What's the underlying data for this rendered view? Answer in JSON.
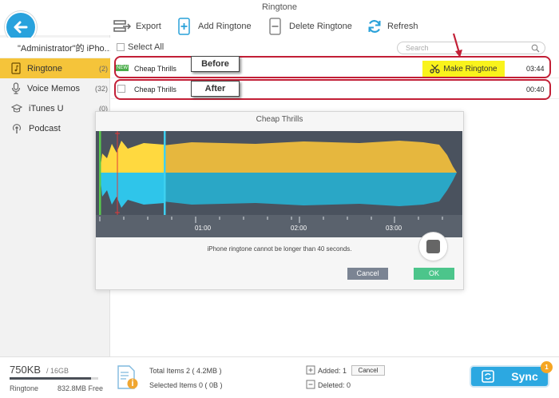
{
  "window": {
    "title": "Ringtone"
  },
  "toolbar": {
    "export_label": "Export",
    "add_label": "Add Ringtone",
    "delete_label": "Delete Ringtone",
    "refresh_label": "Refresh"
  },
  "sidebar": {
    "device_label": "\"Administrator\"的 iPho...",
    "items": [
      {
        "label": "Ringtone",
        "count": "(2)"
      },
      {
        "label": "Voice Memos",
        "count": "(32)"
      },
      {
        "label": "iTunes U",
        "count": "(0)"
      },
      {
        "label": "Podcast",
        "count": ""
      }
    ]
  },
  "list": {
    "select_all_label": "Select All",
    "search_placeholder": "Search",
    "rows": [
      {
        "title": "Cheap Thrills",
        "duration": "03:44",
        "badge": "NEW"
      },
      {
        "title": "Cheap Thrills",
        "duration": "00:40",
        "badge": ""
      }
    ],
    "make_ringtone_label": "Make Ringtone"
  },
  "annotations": {
    "before": "Before",
    "after": "After"
  },
  "dialog": {
    "title": "Cheap Thrills",
    "ticks": [
      "01:00",
      "02:00",
      "03:00"
    ],
    "message": "iPhone ringtone cannot be longer than 40 seconds.",
    "cancel_label": "Cancel",
    "ok_label": "OK"
  },
  "footer": {
    "used": "750KB",
    "capacity": "/ 16GB",
    "category": "Ringtone",
    "free": "832.8MB Free",
    "storage_used_fraction": 0.92,
    "total_items": "Total Items 2 ( 4.2MB )",
    "selected_items": "Selected Items 0 ( 0B )",
    "added": "Added: 1",
    "deleted": "Deleted: 0",
    "cancel_label": "Cancel",
    "sync_label": "Sync",
    "sync_badge": "1"
  },
  "colors": {
    "accent": "#28a2dd",
    "selected": "#f5c43a",
    "highlight": "#f9f31c",
    "annotation_red": "#c21f36",
    "ok_green": "#4cc58b"
  }
}
